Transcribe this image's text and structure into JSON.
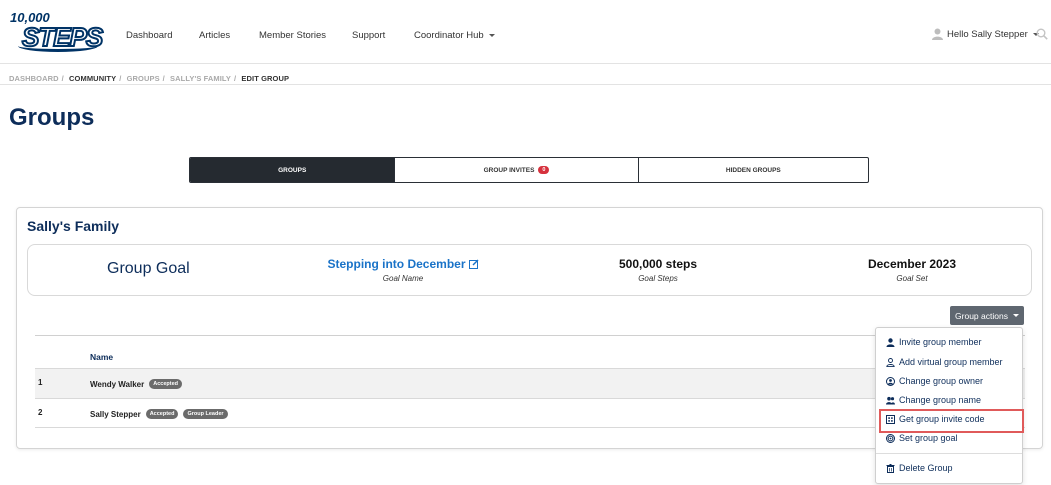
{
  "logo": {
    "top_text": "10,000",
    "main_text": "STEPS"
  },
  "nav": {
    "items": [
      "Dashboard",
      "Articles",
      "Member Stories",
      "Support",
      "Coordinator Hub"
    ],
    "user_greeting": "Hello Sally Stepper"
  },
  "breadcrumb": [
    "DASHBOARD",
    "COMMUNITY",
    "GROUPS",
    "SALLY'S FAMILY",
    "EDIT GROUP"
  ],
  "page_title": "Groups",
  "tabs": {
    "groups": "GROUPS",
    "invites": "GROUP INVITES",
    "invites_count": "0",
    "hidden": "HIDDEN GROUPS"
  },
  "group": {
    "name": "Sally's Family",
    "goal_label": "Group Goal",
    "goal_name": "Stepping into December",
    "goal_name_caption": "Goal Name",
    "goal_steps": "500,000 steps",
    "goal_steps_caption": "Goal Steps",
    "goal_set": "December 2023",
    "goal_set_caption": "Goal Set"
  },
  "actions_button": "Group actions",
  "table": {
    "header_name": "Name",
    "rows": [
      {
        "num": "1",
        "name": "Wendy Walker",
        "badges": [
          "Accepted"
        ]
      },
      {
        "num": "2",
        "name": "Sally Stepper",
        "badges": [
          "Accepted",
          "Group Leader"
        ]
      }
    ]
  },
  "dropdown": {
    "items": [
      "Invite group member",
      "Add virtual group member",
      "Change group owner",
      "Change group name",
      "Get group invite code",
      "Set group goal",
      "Delete Group"
    ]
  },
  "colors": {
    "brand_navy": "#0d2d5a",
    "link_blue": "#1a73c8",
    "highlight_red": "#e05a5a",
    "badge_red": "#d6313d"
  }
}
